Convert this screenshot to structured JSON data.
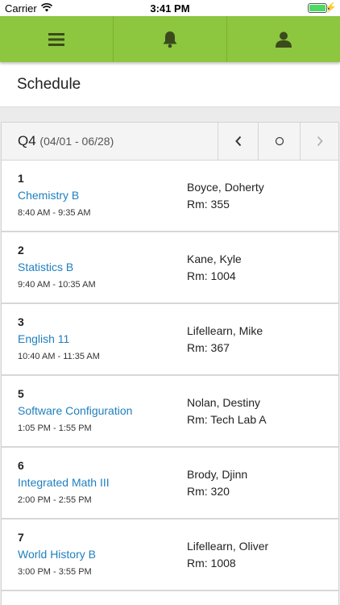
{
  "status": {
    "carrier": "Carrier",
    "time": "3:41 PM"
  },
  "nav": {
    "icons": [
      "menu-icon",
      "bell-icon",
      "user-icon"
    ],
    "color": "#8dc63f"
  },
  "page": {
    "title": "Schedule"
  },
  "quarter": {
    "label": "Q4",
    "range": "(04/01 - 06/28)",
    "prev": "‹",
    "current": "○",
    "next": "›"
  },
  "periods": [
    {
      "period": "1",
      "course": "Chemistry B",
      "time": "8:40 AM - 9:35 AM",
      "teacher": "Boyce, Doherty",
      "room": "Rm: 355"
    },
    {
      "period": "2",
      "course": "Statistics B",
      "time": "9:40 AM - 10:35 AM",
      "teacher": "Kane, Kyle",
      "room": "Rm: 1004"
    },
    {
      "period": "3",
      "course": "English 11",
      "time": "10:40 AM - 11:35 AM",
      "teacher": "Lifellearn, Mike",
      "room": "Rm: 367"
    },
    {
      "period": "5",
      "course": "Software Configuration",
      "time": "1:05 PM - 1:55 PM",
      "teacher": "Nolan, Destiny",
      "room": "Rm: Tech Lab A"
    },
    {
      "period": "6",
      "course": "Integrated Math III",
      "time": "2:00 PM - 2:55 PM",
      "teacher": "Brody, Djinn",
      "room": "Rm: 320"
    },
    {
      "period": "7",
      "course": "World History B",
      "time": "3:00 PM - 3:55 PM",
      "teacher": "Lifellearn, Oliver",
      "room": "Rm: 1008"
    }
  ],
  "colors": {
    "link": "#1f7fbf",
    "navbar": "#8dc63f",
    "battery": "#4cd964"
  }
}
